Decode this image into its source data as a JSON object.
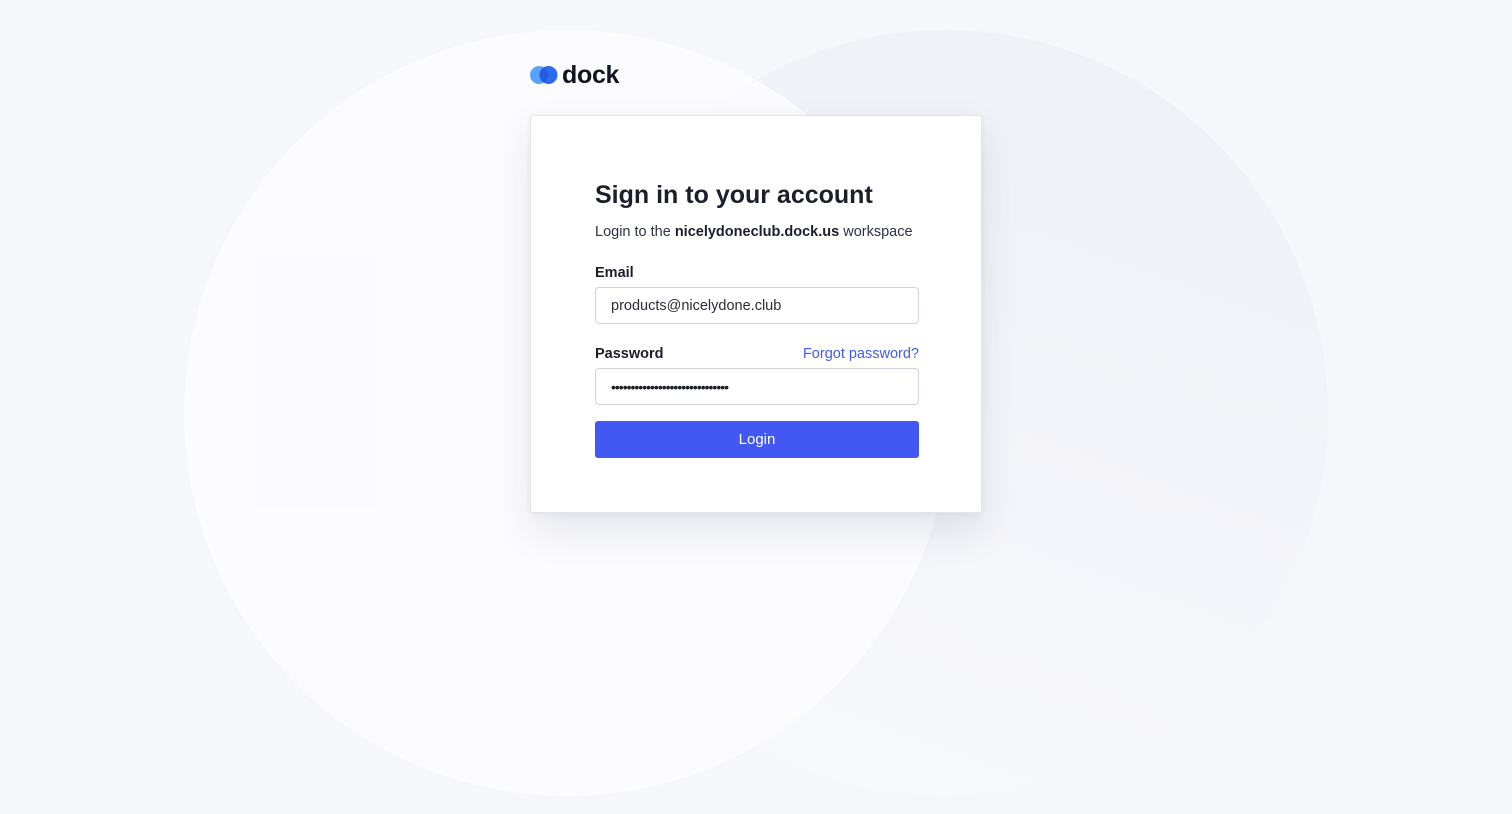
{
  "brand": {
    "name": "dock",
    "mark_icon": "dock-logo-icon",
    "colors": {
      "light": "#5aa2ff",
      "dark": "#2f6bf0"
    }
  },
  "login": {
    "title": "Sign in to your account",
    "subtitle_prefix": "Login to the ",
    "workspace": "nicelydoneclub.dock.us",
    "subtitle_suffix": " workspace",
    "email_label": "Email",
    "email_value": "products@nicelydone.club",
    "password_label": "Password",
    "forgot_password": "Forgot password?",
    "password_masked": "••••••••••••••••••••••••••••••",
    "login_button": "Login"
  },
  "colors": {
    "accent": "#4258f2",
    "link": "#3f5bf0",
    "background": "#f6f7fb"
  }
}
